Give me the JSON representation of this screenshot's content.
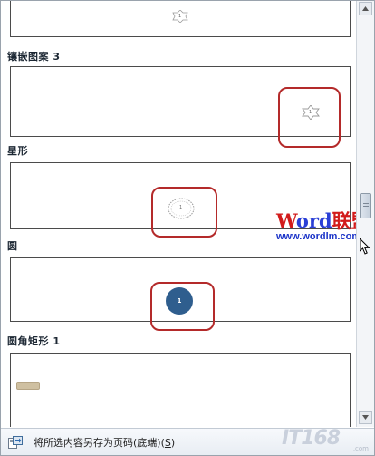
{
  "gallery": {
    "items": [
      {
        "label": "",
        "page_number": "1"
      },
      {
        "label": "镶嵌图案 3",
        "page_number": "1"
      },
      {
        "label": "星形",
        "page_number": "1"
      },
      {
        "label": "圆",
        "page_number": "1"
      },
      {
        "label": "圆角矩形 1",
        "page_number": ""
      }
    ]
  },
  "footer": {
    "save_selection_label": "将所选内容另存为页码(底端)(",
    "save_selection_hotkey": "S",
    "save_selection_suffix": ")"
  },
  "watermark": {
    "brand_w": "W",
    "brand_ord": "ord",
    "brand_cn": "联盟",
    "url": "www.wordlm.com"
  },
  "logo": {
    "text": "IT168",
    "url": ".com"
  },
  "colors": {
    "highlight": "#b42a2a",
    "circle_fill": "#2f5e8e",
    "brand_red": "#d21b1b",
    "brand_blue": "#2a3fd6",
    "url_blue": "#1a33c8"
  }
}
